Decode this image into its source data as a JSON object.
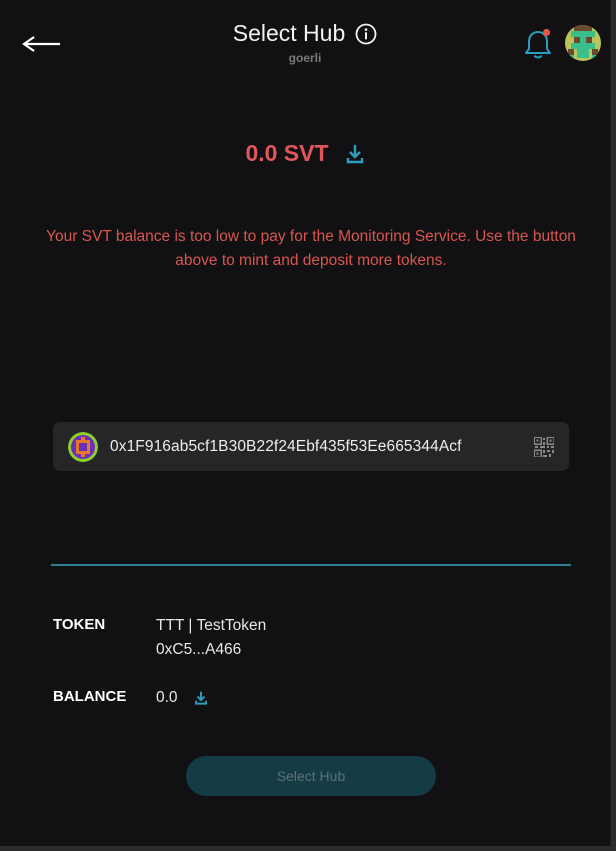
{
  "header": {
    "title": "Select Hub",
    "network": "goerli"
  },
  "balance": {
    "amount": "0.0 SVT"
  },
  "warning": {
    "text": "Your SVT balance is too low to pay for the Monitoring Service. Use the button above to mint and deposit more tokens."
  },
  "account": {
    "address": "0x1F916ab5cf1B30B22f24Ebf435f53Ee665344Acf"
  },
  "token_info": {
    "token_label": "TOKEN",
    "token_name": "TTT | TestToken",
    "token_address": "0xC5...A466",
    "balance_label": "BALANCE",
    "balance_value": "0.0"
  },
  "actions": {
    "select_hub_label": "Select Hub"
  },
  "colors": {
    "accent": "#2a9dc0",
    "error": "#e0565a",
    "notification_dot": "#e5534b",
    "background": "#111113"
  }
}
